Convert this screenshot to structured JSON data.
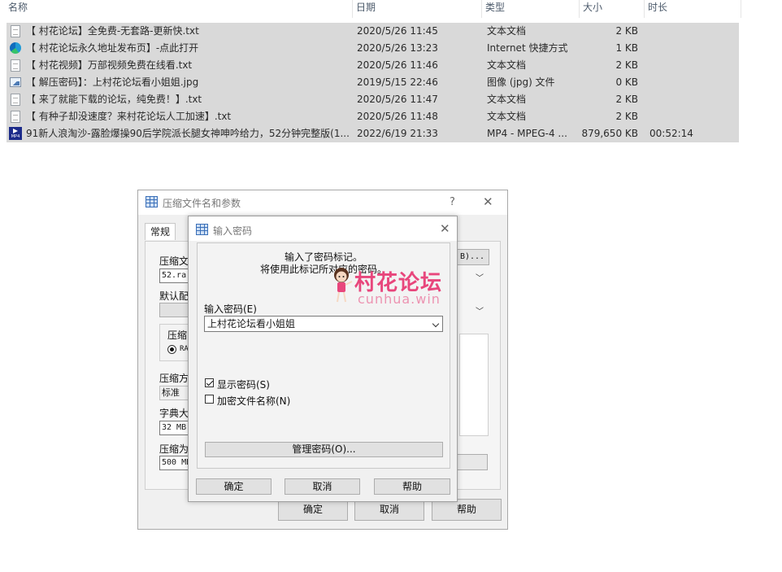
{
  "file_list": {
    "columns": {
      "name": "名称",
      "date": "日期",
      "type": "类型",
      "size": "大小",
      "duration": "时长"
    },
    "rows": [
      {
        "icon": "text-file-icon",
        "name": "【 村花论坛】全免费-无套路-更新快.txt",
        "date": "2020/5/26 11:45",
        "type": "文本文档",
        "size": "2 KB",
        "duration": ""
      },
      {
        "icon": "edge-shortcut-icon",
        "name": "【 村花论坛永久地址发布页】-点此打开",
        "date": "2020/5/26 13:23",
        "type": "Internet 快捷方式",
        "size": "1 KB",
        "duration": ""
      },
      {
        "icon": "text-file-icon",
        "name": "【 村花视频】万部视频免费在线看.txt",
        "date": "2020/5/26 11:46",
        "type": "文本文档",
        "size": "2 KB",
        "duration": ""
      },
      {
        "icon": "image-file-icon",
        "name": "【 解压密码】：上村花论坛看小姐姐.jpg",
        "date": "2019/5/15 22:46",
        "type": "图像 (jpg) 文件",
        "size": "0 KB",
        "duration": ""
      },
      {
        "icon": "text-file-icon",
        "name": "【 来了就能下载的论坛，纯免费！】.txt",
        "date": "2020/5/26 11:47",
        "type": "文本文档",
        "size": "2 KB",
        "duration": ""
      },
      {
        "icon": "text-file-icon",
        "name": "【 有种子却没速度？来村花论坛人工加速】.txt",
        "date": "2020/5/26 11:48",
        "type": "文本文档",
        "size": "2 KB",
        "duration": ""
      },
      {
        "icon": "mp4-file-icon",
        "name": "91新人浪淘沙-露脸爆操90后学院派长腿女神呻吟给力，52分钟完整版(1...",
        "date": "2022/6/19 21:33",
        "type": "MP4 - MPEG-4 ...",
        "size": "879,650 KB",
        "duration": "00:52:14"
      }
    ]
  },
  "back_dialog": {
    "title": "压缩文件名和参数",
    "help_glyph": "?",
    "tab_general": "常规",
    "archive_name_label": "压缩文",
    "archive_name_value": "52.ra",
    "browse_label": "B)...",
    "default_profile_label": "默认配",
    "format_label": "压缩",
    "format_option": "RA",
    "method_label": "压缩方",
    "method_value": "标准",
    "dict_label": "字典大",
    "dict_value": "32 MB",
    "split_label": "压缩为",
    "split_value": "500 MB",
    "ok": "确定",
    "cancel": "取消",
    "help": "帮助"
  },
  "password_dialog": {
    "title": "输入密码",
    "info_line1": "输入了密码标记。",
    "info_line2": "将使用此标记所对应的密码。",
    "password_label": "输入密码(E)",
    "password_value": "上村花论坛看小姐姐",
    "show_password": "显示密码(S)",
    "show_password_checked": true,
    "encrypt_names": "加密文件名称(N)",
    "encrypt_names_checked": false,
    "manage_button": "管理密码(O)...",
    "ok": "确定",
    "cancel": "取消",
    "help": "帮助"
  },
  "watermark": {
    "title": "村花论坛",
    "url": "cunhua.win",
    "color": "#e8467c"
  }
}
